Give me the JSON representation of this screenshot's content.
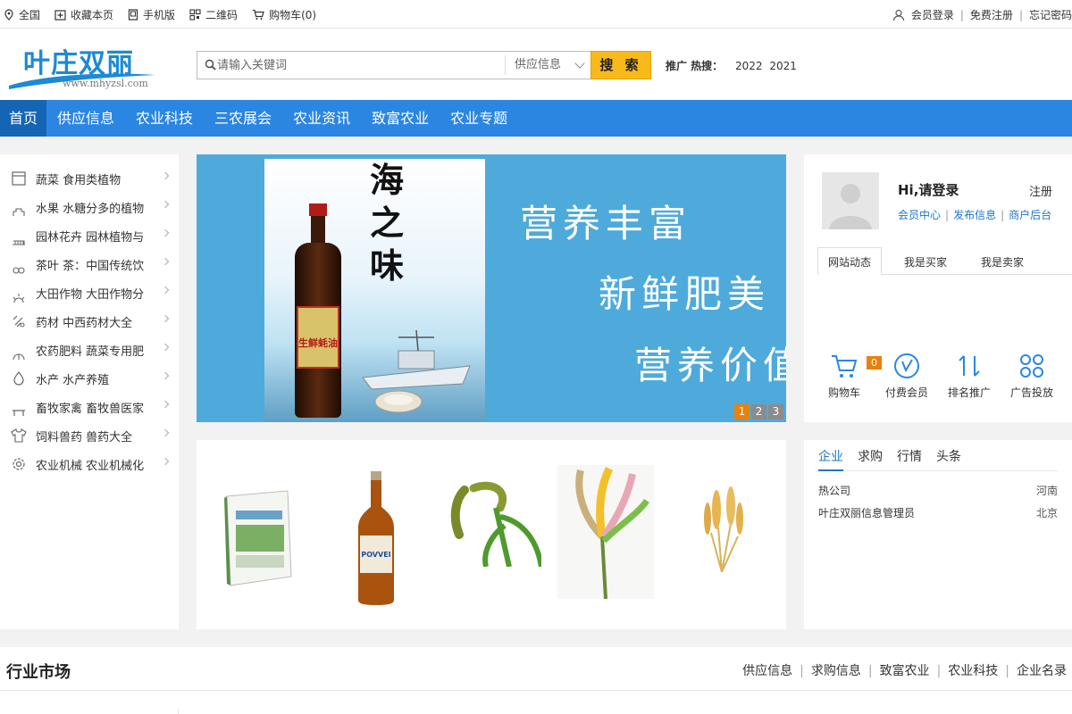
{
  "topbar": {
    "location": "全国",
    "bookmark": "收藏本页",
    "mobile": "手机版",
    "qrcode": "二维码",
    "cart": "购物车(0)",
    "login": "会员登录",
    "register": "免费注册",
    "forgot": "忘记密码"
  },
  "header": {
    "logo_text": "叶庄双丽",
    "logo_url": "www.mhyzsl.com",
    "search_placeholder": "请输入关键词",
    "search_category": "供应信息",
    "search_button": "搜 索",
    "hot_label": "推广 热搜：",
    "hot_keywords": [
      "2022",
      "2021"
    ]
  },
  "nav": {
    "items": [
      "首页",
      "供应信息",
      "农业科技",
      "三农展会",
      "农业资讯",
      "致富农业",
      "农业专题"
    ]
  },
  "categories": [
    {
      "label": "蔬菜 食用类植物",
      "icon": "box-icon"
    },
    {
      "label": "水果 水糖分多的植物",
      "icon": "fruit-icon"
    },
    {
      "label": "园林花卉 园林植物与",
      "icon": "flower-icon"
    },
    {
      "label": "茶叶 茶：中国传统饮",
      "icon": "tea-icon"
    },
    {
      "label": "大田作物 大田作物分",
      "icon": "field-crop-icon"
    },
    {
      "label": "药材 中西药材大全",
      "icon": "herb-icon"
    },
    {
      "label": "农药肥料 蔬菜专用肥",
      "icon": "fertilizer-icon"
    },
    {
      "label": "水产 水产养殖",
      "icon": "water-drop-icon"
    },
    {
      "label": "畜牧家禽 畜牧兽医家",
      "icon": "livestock-icon"
    },
    {
      "label": "饲料兽药 兽药大全",
      "icon": "shirt-icon"
    },
    {
      "label": "农业机械 农业机械化",
      "icon": "gear-icon"
    }
  ],
  "banner": {
    "title_art": "海之味",
    "product_label": "生鲜蚝油",
    "lines": [
      "营养丰富",
      "新鲜肥美",
      "营养价值"
    ],
    "dots": [
      "1",
      "2",
      "3"
    ],
    "active_dot": 0
  },
  "products": [
    {
      "name": "book-product-image"
    },
    {
      "name": "bottle-product-image"
    },
    {
      "name": "millet-product-image"
    },
    {
      "name": "dried-flowers-product-image"
    },
    {
      "name": "wheat-product-image"
    }
  ],
  "user": {
    "greeting": "Hi,请登录",
    "register": "注册",
    "member_center": "会员中心",
    "publish": "发布信息",
    "merchant_backend": "商户后台",
    "tabs": [
      "网站动态",
      "我是买家",
      "我是卖家"
    ],
    "tools": [
      {
        "label": "购物车",
        "icon": "cart-icon"
      },
      {
        "label": "付费会员",
        "icon": "vip-icon"
      },
      {
        "label": "排名推广",
        "icon": "rank-icon"
      },
      {
        "label": "广告投放",
        "icon": "ads-icon"
      }
    ],
    "cart_count": "0"
  },
  "news": {
    "tabs": [
      "企业",
      "求购",
      "行情",
      "头条"
    ],
    "rows": [
      {
        "name": "热公司",
        "region": "河南"
      },
      {
        "name": "叶庄双丽信息管理员",
        "region": "北京"
      }
    ]
  },
  "market": {
    "title": "行业市场",
    "links": [
      "供应信息",
      "求购信息",
      "致富农业",
      "农业科技",
      "企业名录"
    ]
  },
  "colors": {
    "nav": "#2b86e2",
    "nav_active": "#1565b5",
    "search_button": "#f8b91b",
    "accent_orange": "#e8820c",
    "link_blue": "#1c76c9"
  }
}
